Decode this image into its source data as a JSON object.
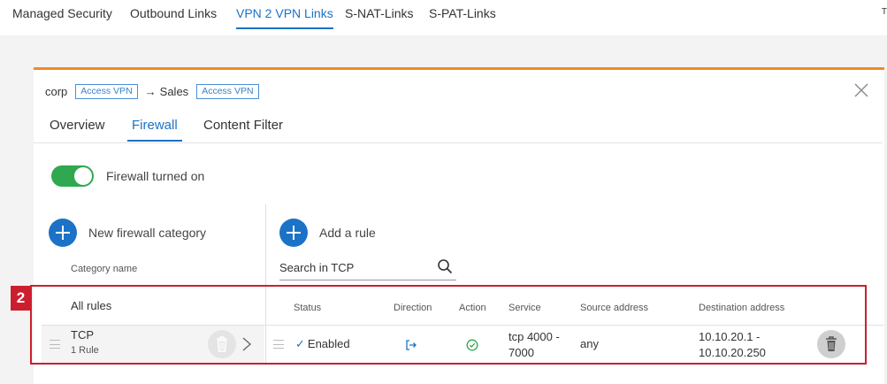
{
  "topnav": {
    "tabs": [
      {
        "label": "Managed Security"
      },
      {
        "label": "Outbound Links"
      },
      {
        "label": "VPN 2 VPN Links"
      },
      {
        "label": "S-NAT-Links"
      },
      {
        "label": "S-PAT-Links"
      }
    ],
    "active_tab": "VPN 2 VPN Links",
    "edge_mark": "T"
  },
  "breadcrumb": {
    "source": "corp",
    "source_tag": "Access VPN",
    "arrow": "→",
    "target": "Sales",
    "target_tag": "Access VPN"
  },
  "subtabs": [
    {
      "label": "Overview"
    },
    {
      "label": "Firewall"
    },
    {
      "label": "Content Filter"
    }
  ],
  "active_subtab": "Firewall",
  "firewall_toggle": {
    "on": true,
    "label": "Firewall turned on"
  },
  "left_column": {
    "new_category_label": "New firewall category",
    "category_name_header": "Category name",
    "all_rules_label": "All rules",
    "categories": [
      {
        "name": "TCP",
        "count": "1 Rule"
      }
    ]
  },
  "right_column": {
    "add_rule_label": "Add a rule",
    "search_placeholder": "Search in TCP",
    "headers": {
      "status": "Status",
      "direction": "Direction",
      "action": "Action",
      "service": "Service",
      "source": "Source address",
      "destination": "Destination address"
    },
    "rules": [
      {
        "status": "Enabled",
        "service_line1": "tcp 4000 -",
        "service_line2": "7000",
        "source": "any",
        "destination_line1": "10.10.20.1 -",
        "destination_line2": "10.10.20.250"
      }
    ]
  },
  "callout": {
    "number": "2"
  },
  "colors": {
    "accent": "#1b72c6",
    "panel_top_border": "#f08a24",
    "toggle_on": "#2fa84f",
    "action_allow": "#2fa84f",
    "callout": "#cc1f2e"
  },
  "icons": {
    "close": "close-icon",
    "search": "search-icon",
    "plus": "plus-icon",
    "drag": "drag-handle-icon",
    "trash": "trash-icon",
    "chevron": "chevron-right-icon",
    "direction": "outbound-arrow-icon",
    "action": "check-circle-icon"
  }
}
